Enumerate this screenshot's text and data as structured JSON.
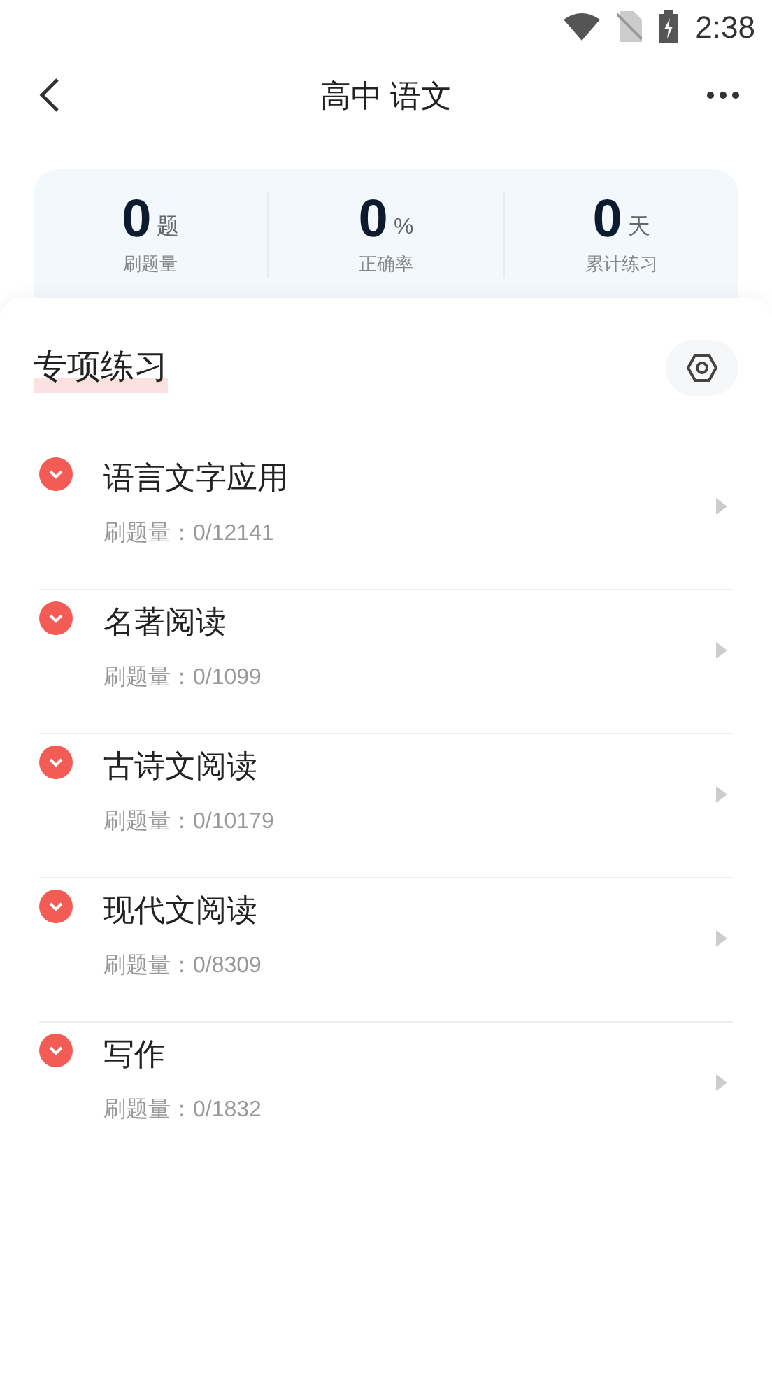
{
  "status_bar": {
    "time": "2:38"
  },
  "header": {
    "title": "高中 语文"
  },
  "stats": [
    {
      "value": "0",
      "unit": "题",
      "label": "刷题量"
    },
    {
      "value": "0",
      "unit": "%",
      "label": "正确率"
    },
    {
      "value": "0",
      "unit": "天",
      "label": "累计练习"
    }
  ],
  "section": {
    "title": "专项练习"
  },
  "items": [
    {
      "title": "语言文字应用",
      "count": "刷题量：0/12141"
    },
    {
      "title": "名著阅读",
      "count": "刷题量：0/1099"
    },
    {
      "title": "古诗文阅读",
      "count": "刷题量：0/10179"
    },
    {
      "title": "现代文阅读",
      "count": "刷题量：0/8309"
    },
    {
      "title": "写作",
      "count": "刷题量：0/1832"
    }
  ]
}
